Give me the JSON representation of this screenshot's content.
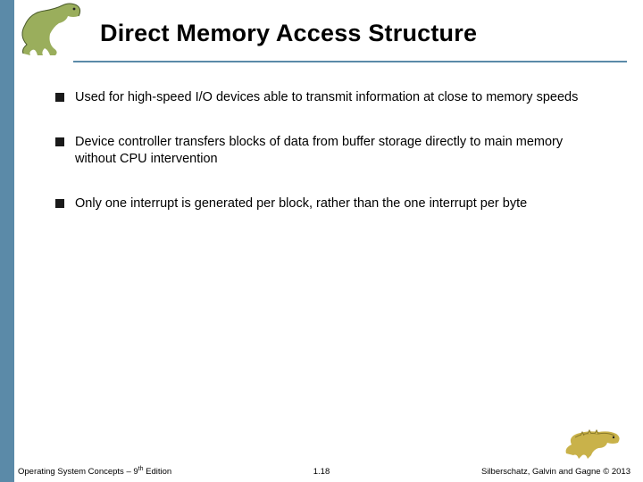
{
  "title": "Direct Memory Access Structure",
  "bullets": [
    "Used for high-speed I/O devices able to transmit information at close to memory speeds",
    "Device controller transfers blocks of data from buffer storage directly to main memory without CPU intervention",
    "Only one interrupt is generated per block, rather than the one interrupt per byte"
  ],
  "footer": {
    "left_prefix": "Operating System Concepts – 9",
    "left_suffix": " Edition",
    "left_super": "th",
    "center": "1.18",
    "right": "Silberschatz, Galvin and Gagne © 2013"
  }
}
